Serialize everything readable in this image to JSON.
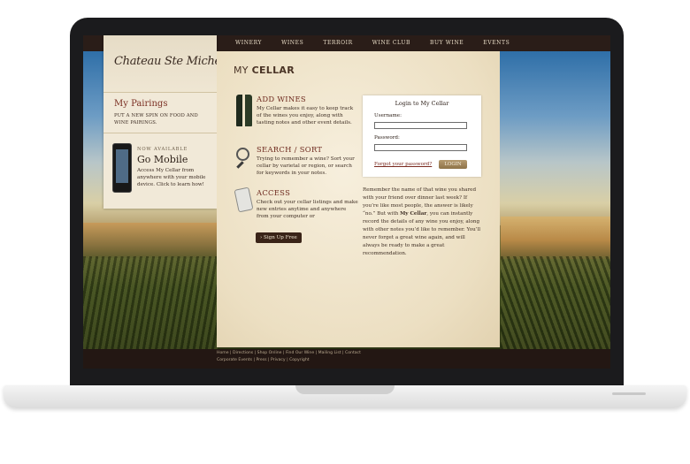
{
  "nav": [
    "WINERY",
    "WINES",
    "TERROIR",
    "WINE CLUB",
    "BUY WINE",
    "EVENTS"
  ],
  "logo_text": "Chateau Ste Michelle",
  "sidebar": {
    "pairings_title": "My Pairings",
    "pairings_sub": "PUT A NEW SPIN ON FOOD AND WINE PAIRINGS.",
    "mobile_kicker": "NOW AVAILABLE",
    "mobile_title": "Go Mobile",
    "mobile_text": "Access My Cellar from anywhere with your mobile device. Click to learn how!"
  },
  "page_title_light": "MY",
  "page_title_bold": "CELLAR",
  "features": [
    {
      "icon": "wine-bottles-icon",
      "title": "ADD WINES",
      "text": "My Cellar makes it easy to keep track of the wines you enjoy, along with tasting notes and other event details."
    },
    {
      "icon": "magnifier-icon",
      "title": "SEARCH / SORT",
      "text": "Trying to remember a wine? Sort your cellar by varietal or region, or search for keywords in your notes."
    },
    {
      "icon": "phone-icon",
      "title": "ACCESS",
      "text": "Check out your cellar listings and make new entries anytime and anywhere from your computer or"
    }
  ],
  "signup_label": "› Sign Up Free",
  "login": {
    "title": "Login to My Cellar",
    "username_label": "Username:",
    "password_label": "Password:",
    "forgot_label": "Forgot your password?",
    "button_label": "LOGIN"
  },
  "blurb": {
    "part1": "Remember the name of that wine you shared with your friend over dinner last week? If you’re like most people, the answer is likely “no.” But with ",
    "bold": "My Cellar",
    "part2": ", you can instantly record the details of any wine you enjoy, along with other notes you’d like to remember. You’ll never forget a great wine again, and will always be ready to make a great recommendation."
  },
  "footer_line1": "Home | Directions | Shop Online | Find Our Wine | Mailing List | Contact",
  "footer_line2": "Corporate Events | Press | Privacy | Copyright"
}
